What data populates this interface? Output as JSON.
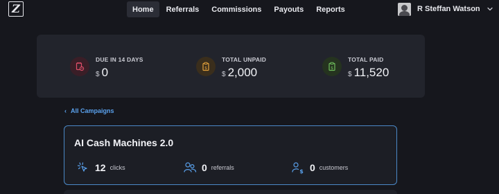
{
  "nav": {
    "items": [
      {
        "label": "Home",
        "active": true
      },
      {
        "label": "Referrals",
        "active": false
      },
      {
        "label": "Commissions",
        "active": false
      },
      {
        "label": "Payouts",
        "active": false
      },
      {
        "label": "Reports",
        "active": false
      }
    ]
  },
  "user": {
    "name": "R Steffan Watson"
  },
  "stats": {
    "due": {
      "label": "DUE IN 14 DAYS",
      "currency": "$",
      "value": "0",
      "color": "#e0506a"
    },
    "unpaid": {
      "label": "TOTAL UNPAID",
      "currency": "$",
      "value": "2,000",
      "color": "#e3a23c"
    },
    "paid": {
      "label": "TOTAL PAID",
      "currency": "$",
      "value": "11,520",
      "color": "#6fbf5c"
    }
  },
  "back_link": {
    "label": "All Campaigns"
  },
  "campaign": {
    "title": "AI Cash Machines 2.0",
    "clicks": {
      "value": "12",
      "label": "clicks"
    },
    "referrals": {
      "value": "0",
      "label": "referrals"
    },
    "customers": {
      "value": "0",
      "label": "customers"
    }
  },
  "colors": {
    "accent": "#5aa2ee",
    "card_border": "#4b89c8",
    "background": "#16171d"
  }
}
